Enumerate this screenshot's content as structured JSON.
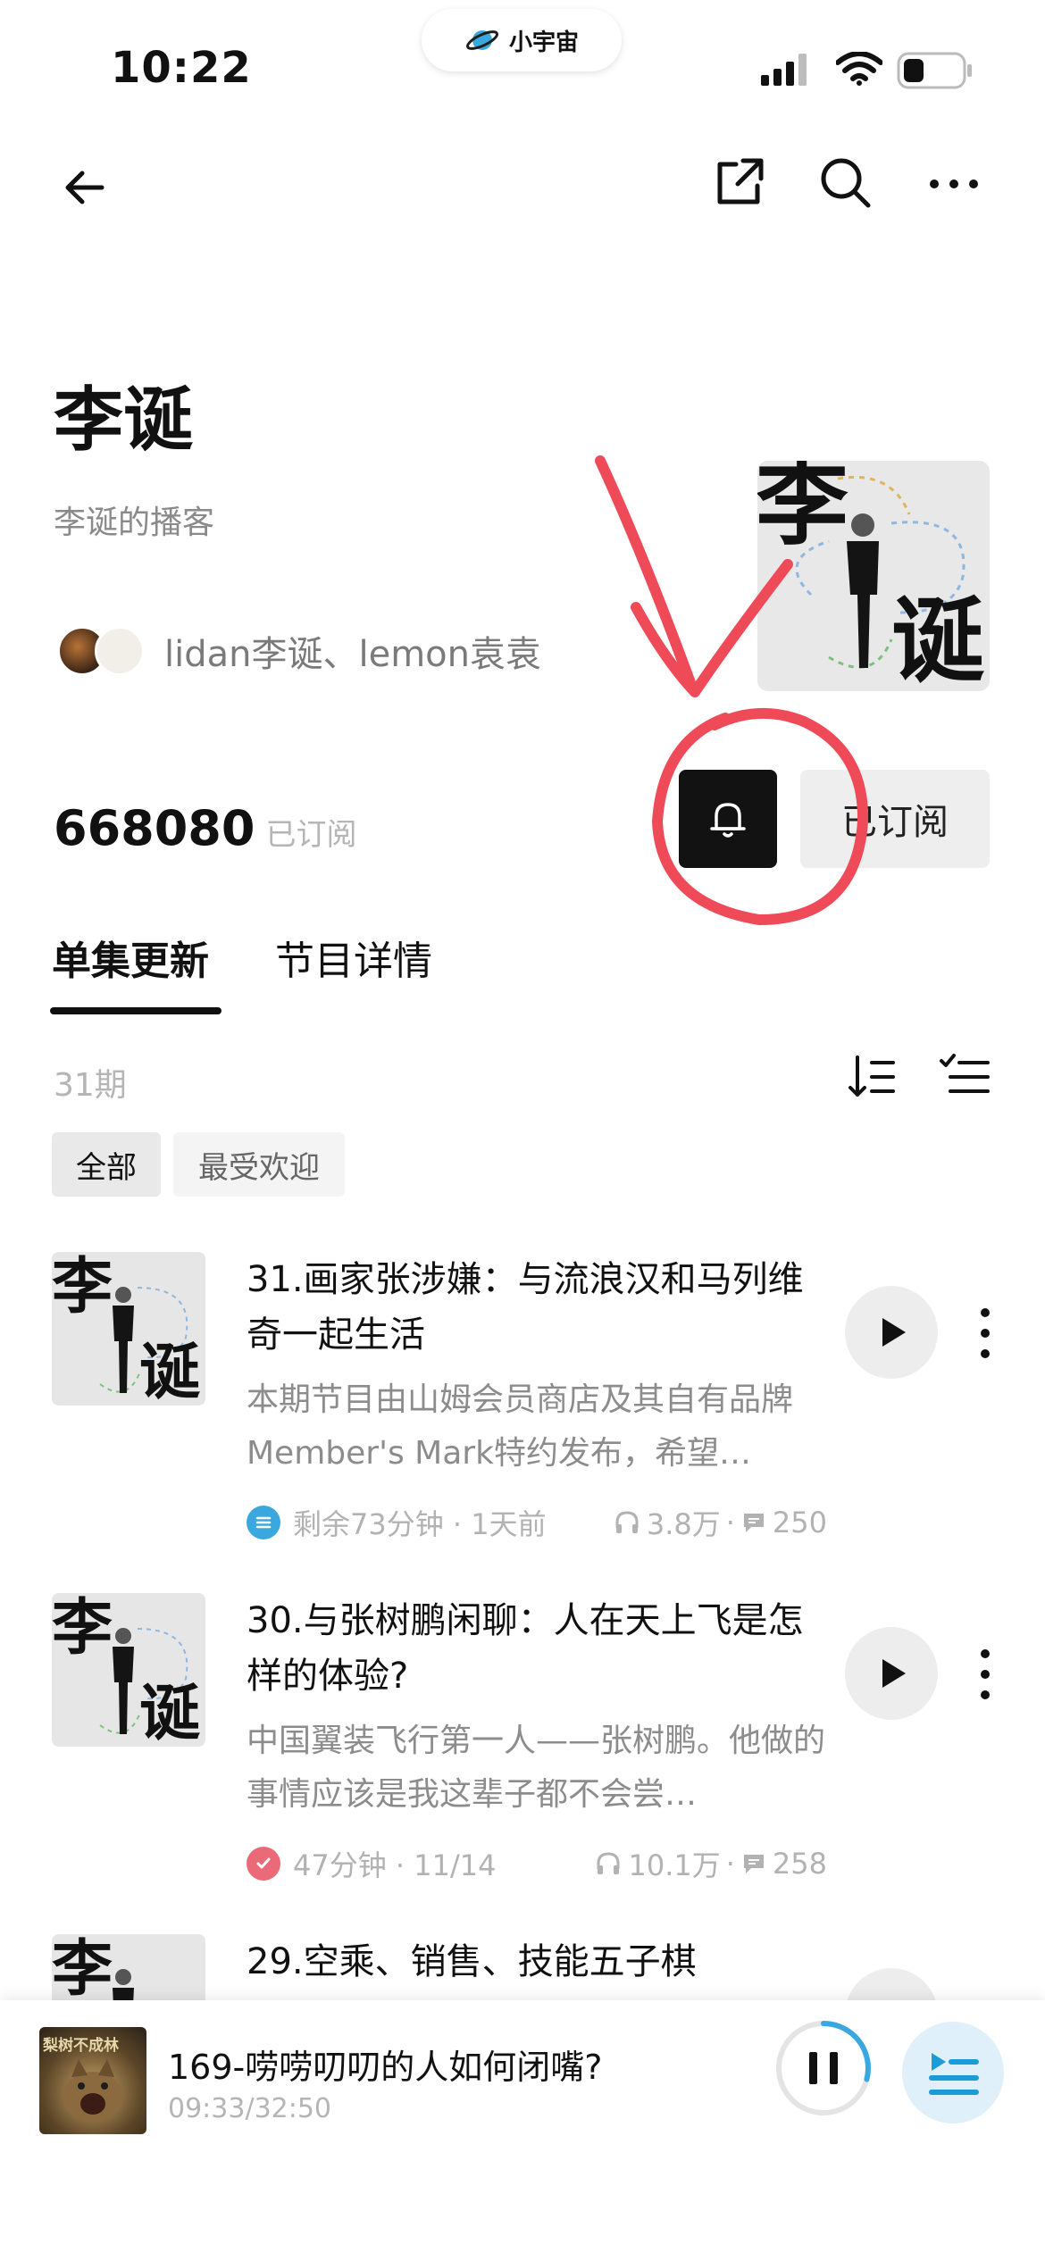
{
  "status_bar": {
    "time": "10:22",
    "app_pill_label": "小宇宙"
  },
  "nav": {
    "back_icon": "arrow-left-icon",
    "share_icon": "share-icon",
    "search_icon": "search-icon",
    "more_icon": "more-horizontal-icon"
  },
  "podcast": {
    "title": "李诞",
    "subtitle": "李诞的播客",
    "hosts": "lidan李诞、lemon袁袁",
    "cover_text_top": "李",
    "cover_text_bottom": "诞",
    "subscriber_count": "668080",
    "subscriber_label": "已订阅",
    "subscribe_button_label": "已订阅",
    "bell_icon": "bell-icon"
  },
  "tabs": [
    {
      "label": "单集更新",
      "active": true
    },
    {
      "label": "节目详情",
      "active": false
    }
  ],
  "episode_list": {
    "count_label": "31期",
    "filters": [
      {
        "label": "全部",
        "selected": true
      },
      {
        "label": "最受欢迎",
        "selected": false
      }
    ]
  },
  "episodes": [
    {
      "title": "31.画家张涉嫌：与流浪汉和马列维奇一起生活",
      "description": "本期节目由山姆会员商店及其自有品牌Member's Mark特约发布，希望…",
      "status": "剩余73分钟 · 1天前",
      "status_icon": "in-progress-icon",
      "status_color": "#3aa8de",
      "plays": "3.8万",
      "comments": "250"
    },
    {
      "title": "30.与张树鹏闲聊：人在天上飞是怎样的体验?",
      "description": "中国翼装飞行第一人——张树鹏。他做的事情应该是我这辈子都不会尝…",
      "status": "47分钟 · 11/14",
      "status_icon": "check-icon",
      "status_color": "#ea6a78",
      "plays": "10.1万",
      "comments": "258"
    },
    {
      "title": "29.空乘、销售、技能五子棋",
      "description": "",
      "status": "",
      "status_icon": "",
      "status_color": "",
      "plays": "",
      "comments": ""
    }
  ],
  "mini_player": {
    "title": "169-唠唠叨叨的人如何闭嘴?",
    "progress": "09:33/32:50",
    "progress_fraction": 0.29,
    "cover_text": "梨树不成林"
  },
  "colors": {
    "accent_blue": "#3aa8de",
    "annotation_red": "#ee4a57",
    "dark_button": "#121212"
  }
}
